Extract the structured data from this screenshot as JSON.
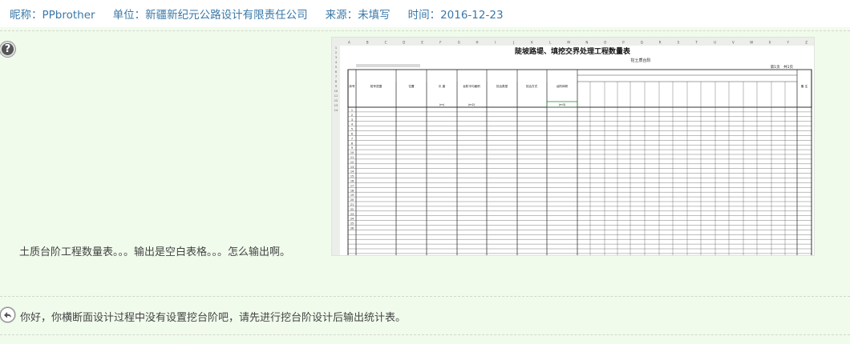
{
  "meta": {
    "nickname": "昵称：PPbrother",
    "unit": "单位：新疆新纪元公路设计有限责任公司",
    "source": "来源：未填写",
    "time": "时间：2016-12-23"
  },
  "question": {
    "text": "土质台阶工程数量表。。。输出是空白表格。。。怎么输出啊。"
  },
  "spreadsheet": {
    "title": "陡坡路堤、填挖交界处理工程数量表",
    "subtitle": "挖土质台阶",
    "page_info": "第1页　共1页",
    "headers": [
      "序号",
      "桩号范围",
      "位置",
      "长 度",
      "台阶平均面积",
      "处治类型",
      "处治方式",
      "台阶体积",
      "备 注"
    ],
    "units": [
      "(m)",
      "(m2)",
      "(m3)"
    ],
    "column_letters": [
      "A",
      "B",
      "C",
      "D",
      "E",
      "F",
      "G",
      "H",
      "I",
      "J",
      "K",
      "L",
      "M",
      "N",
      "O",
      "P",
      "Q",
      "R",
      "S",
      "T",
      "U",
      "V",
      "W",
      "X",
      "Y",
      "Z"
    ],
    "row_numbers": [
      "1",
      "2",
      "3",
      "4",
      "5",
      "6",
      "7",
      "8",
      "9",
      "10",
      "11",
      "12",
      "13",
      "14",
      "15",
      "16",
      "17",
      "18",
      "19",
      "20",
      "21",
      "22",
      "23",
      "24",
      "25",
      "26"
    ]
  },
  "answer": {
    "text": "你好，你横断面设计过程中没有设置挖台阶吧，请先进行挖台阶设计后输出统计表。"
  }
}
